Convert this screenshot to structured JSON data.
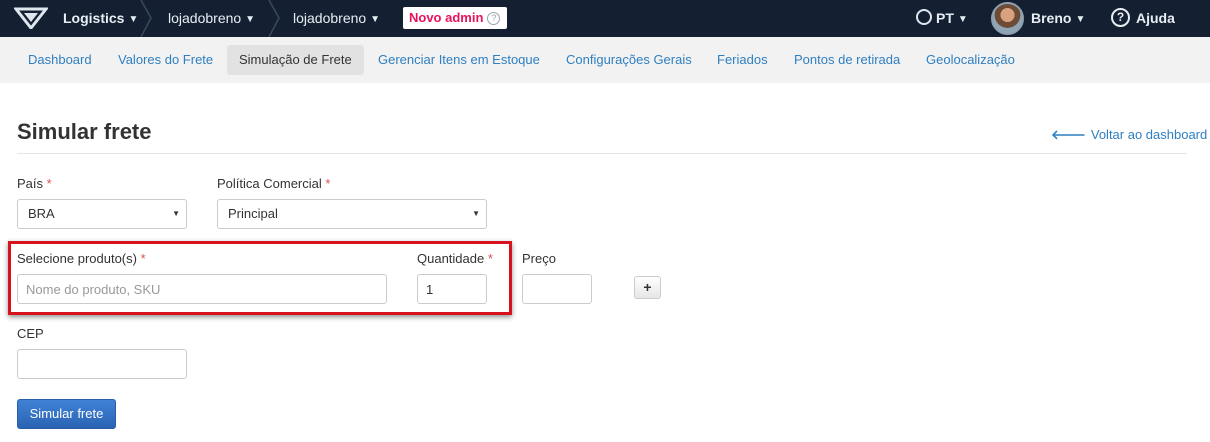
{
  "topbar": {
    "app_name": "Logistics",
    "account1": "lojadobreno",
    "account2": "lojadobreno",
    "badge_label": "Novo admin",
    "badge_help": "?",
    "language": "PT",
    "user_name": "Breno",
    "help_label": "Ajuda",
    "help_icon": "?",
    "chevron": "⌄"
  },
  "nav": {
    "tabs": [
      {
        "label": "Dashboard"
      },
      {
        "label": "Valores do Frete"
      },
      {
        "label": "Simulação de Frete"
      },
      {
        "label": "Gerenciar Itens em Estoque"
      },
      {
        "label": "Configurações Gerais"
      },
      {
        "label": "Feriados"
      },
      {
        "label": "Pontos de retirada"
      },
      {
        "label": "Geolocalização"
      }
    ],
    "active_tab": "Simulação de Frete"
  },
  "page": {
    "title": "Simular frete",
    "back_link": "Voltar ao dashboard",
    "back_arrow": "🡐"
  },
  "form": {
    "country": {
      "label": "País",
      "value": "BRA"
    },
    "policy": {
      "label": "Política Comercial",
      "value": "Principal"
    },
    "product": {
      "label": "Selecione produto(s)",
      "placeholder": "Nome do produto, SKU",
      "value": ""
    },
    "quantity": {
      "label": "Quantidade",
      "value": "1"
    },
    "price": {
      "label": "Preço",
      "value": ""
    },
    "add_button": "+",
    "cep": {
      "label": "CEP",
      "value": ""
    },
    "required_mark": "*",
    "submit_label": "Simular frete"
  },
  "colors": {
    "topbar_bg": "#142032",
    "link": "#2f7fc1",
    "badge_text": "#e8125d",
    "highlight_border": "#d6121f",
    "primary_button": "#2b63b3"
  }
}
